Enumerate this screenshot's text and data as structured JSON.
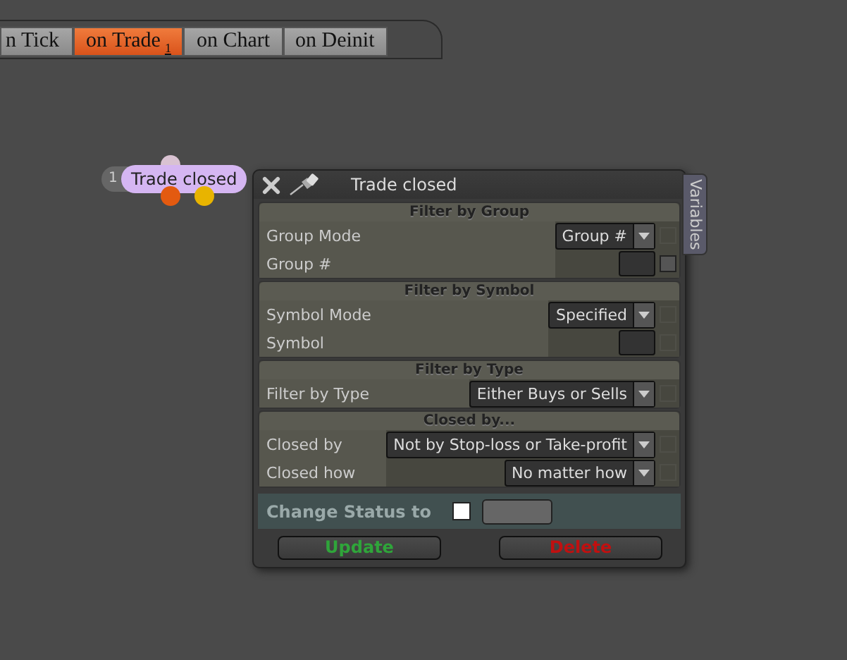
{
  "tabs": [
    {
      "label": "n Tick",
      "selected": false
    },
    {
      "label": "on Trade",
      "badge": "1",
      "selected": true
    },
    {
      "label": "on Chart",
      "selected": false
    },
    {
      "label": "on Deinit",
      "selected": false
    }
  ],
  "node": {
    "number": "1",
    "label": "Trade closed"
  },
  "dialog": {
    "title": "Trade closed",
    "side_tab": "Variables",
    "sections": [
      {
        "title": "Filter by Group",
        "rows": [
          {
            "label": "Group Mode",
            "kind": "select",
            "value": "Group #",
            "toggle_enabled": false
          },
          {
            "label": "Group #",
            "kind": "input",
            "toggle_enabled": true
          }
        ]
      },
      {
        "title": "Filter by Symbol",
        "rows": [
          {
            "label": "Symbol Mode",
            "kind": "select",
            "value": "Specified",
            "toggle_enabled": false
          },
          {
            "label": "Symbol",
            "kind": "input",
            "toggle_enabled": false
          }
        ]
      },
      {
        "title": "Filter by Type",
        "rows": [
          {
            "label": "Filter by Type",
            "kind": "select",
            "value": "Either Buys or Sells",
            "toggle_enabled": false
          }
        ]
      },
      {
        "title": "Closed by...",
        "rows": [
          {
            "label": "Closed by",
            "kind": "select",
            "value": "Not by Stop-loss or Take-profit",
            "toggle_enabled": false
          },
          {
            "label": "Closed how",
            "kind": "select",
            "value": "No matter how",
            "toggle_enabled": false
          }
        ]
      }
    ],
    "status": {
      "label": "Change Status to",
      "checked": false
    },
    "buttons": [
      {
        "label": "Update",
        "kind": "confirm"
      },
      {
        "label": "Delete",
        "kind": "danger"
      }
    ]
  }
}
